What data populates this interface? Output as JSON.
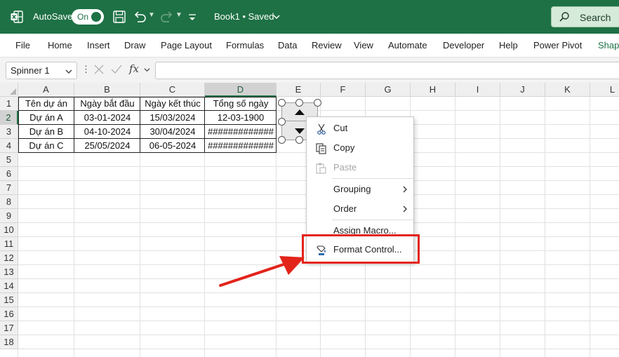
{
  "titlebar": {
    "autosave_label": "AutoSave",
    "toggle_label": "On",
    "doc_title": "Book1 • Saved",
    "search_label": "Search",
    "colors": {
      "bar": "#1e7145",
      "search_bg": "#d5ead9"
    }
  },
  "ribbon": {
    "tabs": [
      "File",
      "Home",
      "Insert",
      "Draw",
      "Page Layout",
      "Formulas",
      "Data",
      "Review",
      "View",
      "Automate",
      "Developer",
      "Help",
      "Power Pivot",
      "Shap"
    ]
  },
  "formula_bar": {
    "name_box": "Spinner 1",
    "fx_label": "fx",
    "formula_value": ""
  },
  "grid": {
    "columns": [
      "A",
      "B",
      "C",
      "D",
      "E",
      "F",
      "G",
      "H",
      "I",
      "J",
      "K",
      "L"
    ],
    "selected_column": "D",
    "rows": [
      "1",
      "2",
      "3",
      "4",
      "5",
      "6",
      "7",
      "8",
      "9",
      "10",
      "11",
      "12",
      "13",
      "14",
      "15",
      "16",
      "17",
      "18"
    ],
    "selected_row": "2",
    "table": {
      "headers": [
        "Tên dự án",
        "Ngày bắt đầu",
        "Ngày kết thúc",
        "Tổng số ngày"
      ],
      "rows": [
        [
          "Dự án A",
          "03-01-2024",
          "15/03/2024",
          "12-03-1900"
        ],
        [
          "Dự án B",
          "04-10-2024",
          "30/04/2024",
          "#############"
        ],
        [
          "Dự án C",
          "25/05/2024",
          "06-05-2024",
          "#############"
        ]
      ]
    }
  },
  "context_menu": {
    "items": [
      {
        "label": "Cut",
        "icon": "scissors-icon",
        "disabled": false
      },
      {
        "label": "Copy",
        "icon": "copy-icon",
        "disabled": false
      },
      {
        "label": "Paste",
        "icon": "paste-icon",
        "disabled": true
      },
      {
        "label": "Grouping",
        "icon": "",
        "disabled": false,
        "submenu": true
      },
      {
        "label": "Order",
        "icon": "",
        "disabled": false,
        "submenu": true
      },
      {
        "label": "Assign Macro...",
        "icon": "",
        "disabled": false
      },
      {
        "label": "Format Control...",
        "icon": "format-control-icon",
        "disabled": false
      }
    ]
  },
  "annotation": {
    "highlight_color": "#e3241b",
    "target": "Format Control..."
  }
}
